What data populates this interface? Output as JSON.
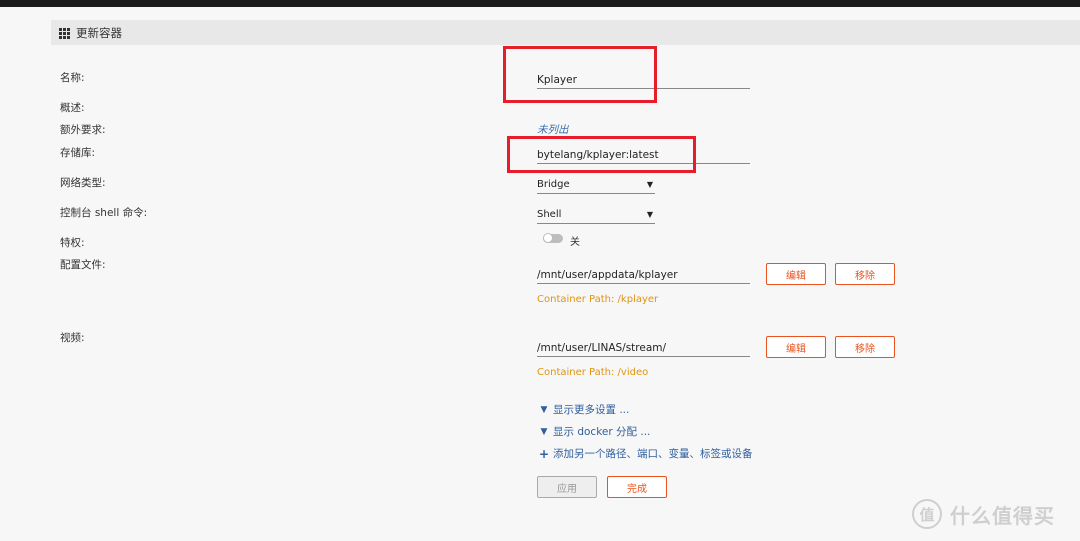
{
  "header": {
    "title": "更新容器"
  },
  "labels": {
    "name": "名称:",
    "overview": "概述:",
    "extra": "额外要求:",
    "repository": "存储库:",
    "network": "网络类型:",
    "console": "控制台 shell 命令:",
    "privileged": "特权:",
    "config": "配置文件:",
    "video": "视频:"
  },
  "fields": {
    "name_value": "Kplayer",
    "extra_value": "未列出",
    "repository_value": "bytelang/kplayer:latest",
    "network_value": "Bridge",
    "console_value": "Shell",
    "privileged_state": "关",
    "config_path": "/mnt/user/appdata/kplayer",
    "config_container_path": "Container Path: /kplayer",
    "video_path": "/mnt/user/LINAS/stream/",
    "video_container_path": "Container Path: /video"
  },
  "buttons": {
    "edit": "编辑",
    "remove": "移除",
    "apply": "应用",
    "done": "完成"
  },
  "links": {
    "more_settings": "显示更多设置 ...",
    "docker_alloc": "显示 docker 分配 ...",
    "add_another": "添加另一个路径、端口、变量、标签或设备"
  },
  "watermark": {
    "logo": "值",
    "text": "什么值得买"
  },
  "colors": {
    "accent": "#e8531f",
    "highlight": "#e81d2c",
    "path": "#e19312",
    "link": "#2f5f9e"
  },
  "icons": [
    "grid-icon",
    "chevron-down-icon",
    "plus-icon",
    "caret-down-icon"
  ]
}
